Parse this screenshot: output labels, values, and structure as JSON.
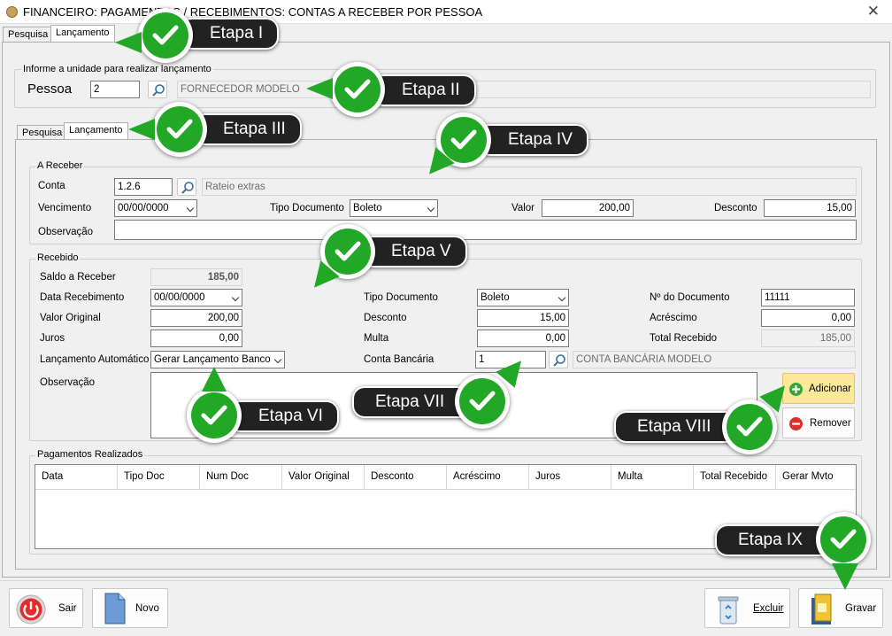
{
  "window": {
    "title": "FINANCEIRO: PAGAMENTOS / RECEBIMENTOS: CONTAS A RECEBER POR PESSOA",
    "close": "✕"
  },
  "outer_tabs": [
    "Pesquisa",
    "Lançamento"
  ],
  "unit": {
    "legend": "Informe a unidade para realizar lançamento",
    "label": "Pessoa",
    "code": "2",
    "name": "FORNECEDOR MODELO"
  },
  "inner_tabs": [
    "Pesquisa",
    "Lançamento"
  ],
  "a_receber": {
    "legend": "A Receber",
    "conta_label": "Conta",
    "conta": "1.2.6",
    "conta_desc": "Rateio extras",
    "venc_label": "Vencimento",
    "venc": "00/00/0000",
    "tipo_label": "Tipo Documento",
    "tipo": "Boleto",
    "valor_label": "Valor",
    "valor": "200,00",
    "desc_label": "Desconto",
    "desc": "15,00",
    "obs_label": "Observação",
    "obs": ""
  },
  "recebido": {
    "legend": "Recebido",
    "saldo_label": "Saldo a Receber",
    "saldo": "185,00",
    "data_label": "Data Recebimento",
    "data": "00/00/0000",
    "vorig_label": "Valor Original",
    "vorig": "200,00",
    "juros_label": "Juros",
    "juros": "0,00",
    "auto_label": "Lançamento Automático",
    "auto": "Gerar Lançamento Banco",
    "obs_label": "Observação",
    "tipo_label": "Tipo Documento",
    "tipo": "Boleto",
    "desc_label": "Desconto",
    "desc": "15,00",
    "multa_label": "Multa",
    "multa": "0,00",
    "cb_label": "Conta Bancária",
    "cb": "1",
    "cb_desc": "CONTA BANCÁRIA MODELO",
    "ndoc_label": "Nº do Documento",
    "ndoc": "11111",
    "acres_label": "Acréscimo",
    "acres": "0,00",
    "total_label": "Total Recebido",
    "total": "185,00",
    "add_label": "Adicionar",
    "remove_label": "Remover"
  },
  "pagamentos": {
    "legend": "Pagamentos Realizados",
    "columns": [
      "Data",
      "Tipo Doc",
      "Num Doc",
      "Valor Original",
      "Desconto",
      "Acréscimo",
      "Juros",
      "Multa",
      "Total Recebido",
      "Gerar Mvto"
    ]
  },
  "footer": {
    "sair": "Sair",
    "novo": "Novo",
    "excluir": "Excluir",
    "gravar": "Gravar"
  },
  "steps": [
    "Etapa I",
    "Etapa II",
    "Etapa III",
    "Etapa IV",
    "Etapa V",
    "Etapa VI",
    "Etapa VII",
    "Etapa VIII",
    "Etapa IX"
  ],
  "colors": {
    "step_green": "#22a826",
    "step_dark": "#222222",
    "add_bg": "#fbe89b"
  }
}
